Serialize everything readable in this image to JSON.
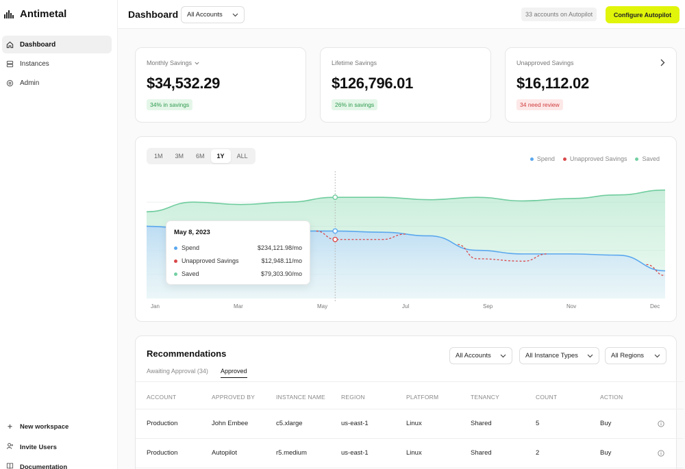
{
  "app": {
    "name": "Antimetal"
  },
  "sidebar": {
    "items": [
      {
        "label": "Dashboard",
        "icon": "home-icon",
        "active": true
      },
      {
        "label": "Instances",
        "icon": "server-icon",
        "active": false
      },
      {
        "label": "Admin",
        "icon": "gear-icon",
        "active": false
      }
    ],
    "footer": [
      {
        "label": "New workspace",
        "icon": "plus-icon"
      },
      {
        "label": "Invite Users",
        "icon": "add-user-icon"
      },
      {
        "label": "Documentation",
        "icon": "book-icon"
      }
    ]
  },
  "header": {
    "title": "Dashboard",
    "account_select": "All Accounts",
    "autopilot_status": "33 accounts on Autopilot",
    "configure_label": "Configure Autopilot",
    "accent_color": "#e0f50a"
  },
  "stats": [
    {
      "label": "Monthly Savings",
      "value": "$34,532.29",
      "badge": "34% in savings",
      "badge_type": "green"
    },
    {
      "label": "Lifetime Savings",
      "value": "$126,796.01",
      "badge": "26% in savings",
      "badge_type": "green"
    },
    {
      "label": "Unapproved Savings",
      "value": "$16,112.02",
      "badge": "34 need review",
      "badge_type": "red"
    }
  ],
  "chart": {
    "ranges": [
      "1M",
      "3M",
      "6M",
      "1Y",
      "ALL"
    ],
    "active_range": "1Y",
    "legend": [
      {
        "name": "Spend",
        "color": "#5aa7ee"
      },
      {
        "name": "Unapproved Savings",
        "color": "#d9484a"
      },
      {
        "name": "Saved",
        "color": "#72cfa2"
      }
    ],
    "months": [
      "Jan",
      "Mar",
      "May",
      "Jul",
      "Sep",
      "Nov",
      "Dec"
    ],
    "tooltip": {
      "date": "May 8, 2023",
      "rows": [
        {
          "label": "Spend",
          "value": "$234,121.98/mo"
        },
        {
          "label": "Unapproved Savings",
          "value": "$12,948.11/mo"
        },
        {
          "label": "Saved",
          "value": "$79,303.90/mo"
        }
      ]
    }
  },
  "chart_data": {
    "type": "area",
    "x": [
      "Jan",
      "Feb",
      "Mar",
      "Apr",
      "May",
      "Jun",
      "Jul",
      "Aug",
      "Sep",
      "Oct",
      "Nov",
      "Dec"
    ],
    "series": [
      {
        "name": "Saved",
        "values": [
          0.72,
          0.8,
          0.78,
          0.8,
          0.84,
          0.84,
          0.82,
          0.84,
          0.81,
          0.83,
          0.86,
          0.9
        ]
      },
      {
        "name": "Spend",
        "values": [
          0.6,
          0.58,
          0.57,
          0.56,
          0.56,
          0.55,
          0.52,
          0.4,
          0.37,
          0.37,
          0.36,
          0.23
        ]
      },
      {
        "name": "Unapproved Savings",
        "values": [
          null,
          null,
          null,
          null,
          0.49,
          0.49,
          null,
          0.33,
          0.31,
          null,
          null,
          0.19
        ]
      }
    ],
    "xlabel": "",
    "ylabel": ""
  },
  "recommendations": {
    "title": "Recommendations",
    "tabs": [
      {
        "label": "Awaiting Approval (34)",
        "active": false
      },
      {
        "label": "Approved",
        "active": true
      }
    ],
    "filters": [
      "All Accounts",
      "All Instance Types",
      "All Regions"
    ],
    "columns": [
      "ACCOUNT",
      "APPROVED BY",
      "INSTANCE NAME",
      "REGION",
      "PLATFORM",
      "TENANCY",
      "COUNT",
      "ACTION"
    ],
    "rows": [
      [
        "Production",
        "John Embee",
        "c5.xlarge",
        "us-east-1",
        "Linux",
        "Shared",
        "5",
        "Buy"
      ],
      [
        "Production",
        "Autopilot",
        "r5.medium",
        "us-east-1",
        "Linux",
        "Shared",
        "2",
        "Buy"
      ]
    ]
  }
}
